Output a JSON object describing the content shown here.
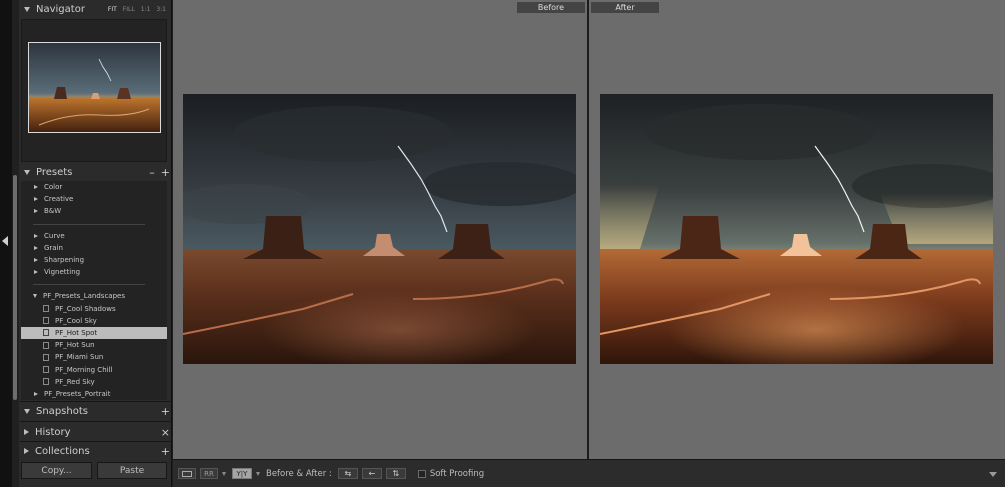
{
  "navigator": {
    "title": "Navigator",
    "modes": [
      "FIT",
      "FILL",
      "1:1",
      "3:1"
    ]
  },
  "presets": {
    "title": "Presets",
    "minus": "–",
    "plus": "+",
    "groups_a": [
      "Color",
      "Creative",
      "B&W"
    ],
    "groups_b": [
      "Curve",
      "Grain",
      "Sharpening",
      "Vignetting"
    ],
    "folder": "PF_Presets_Landscapes",
    "items": [
      "PF_Cool Shadows",
      "PF_Cool Sky",
      "PF_Hot Spot",
      "PF_Hot Sun",
      "PF_Miami Sun",
      "PF_Morning Chill",
      "PF_Red Sky"
    ],
    "selected": "PF_Hot Spot",
    "folder2": "PF_Presets_Portrait"
  },
  "snapshots": {
    "title": "Snapshots",
    "action": "+"
  },
  "history": {
    "title": "History",
    "action": "×"
  },
  "collections": {
    "title": "Collections",
    "action": "+"
  },
  "buttons": {
    "copy": "Copy...",
    "paste": "Paste"
  },
  "compare": {
    "before": "Before",
    "after": "After"
  },
  "toolbar": {
    "loupe_icon": "loupe-icon",
    "rr_label": "RR",
    "yy_label": "Y|Y",
    "before_after_label": "Before & After :",
    "soft_proofing": "Soft Proofing"
  }
}
